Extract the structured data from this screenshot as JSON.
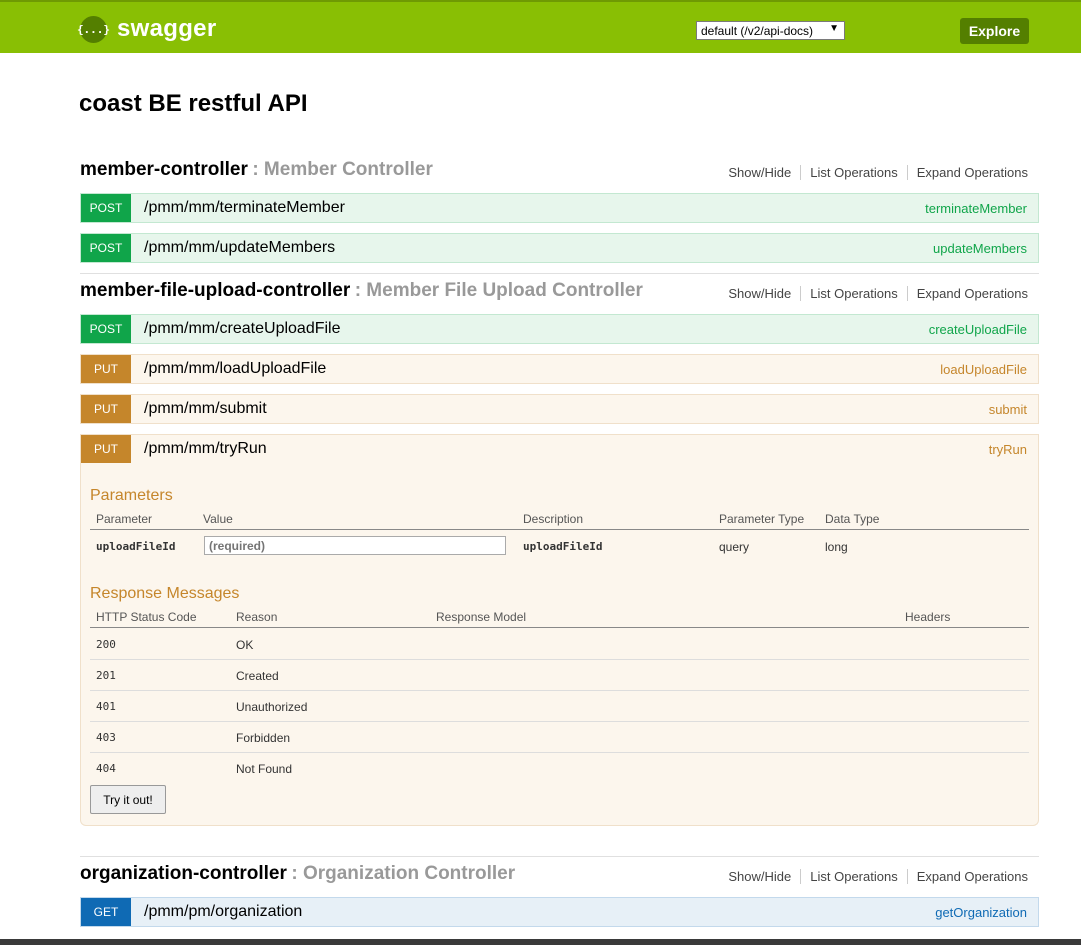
{
  "header": {
    "logo_mark": "{...}",
    "logo_text": "swagger",
    "spec_url": "default (/v2/api-docs)",
    "spec_arrow": "▼",
    "explore_label": "Explore"
  },
  "api_title": "coast BE restful API",
  "section_links": {
    "show_hide": "Show/Hide",
    "list_operations": "List Operations",
    "expand_operations": "Expand Operations"
  },
  "sections": [
    {
      "name": "member-controller",
      "desc": ": Member Controller",
      "operations": [
        {
          "method": "POST",
          "path": "/pmm/mm/terminateMember",
          "nickname": "terminateMember"
        },
        {
          "method": "POST",
          "path": "/pmm/mm/updateMembers",
          "nickname": "updateMembers"
        }
      ]
    },
    {
      "name": "member-file-upload-controller",
      "desc": ": Member File Upload Controller",
      "operations": [
        {
          "method": "POST",
          "path": "/pmm/mm/createUploadFile",
          "nickname": "createUploadFile"
        },
        {
          "method": "PUT",
          "path": "/pmm/mm/loadUploadFile",
          "nickname": "loadUploadFile"
        },
        {
          "method": "PUT",
          "path": "/pmm/mm/submit",
          "nickname": "submit"
        },
        {
          "method": "PUT",
          "path": "/pmm/mm/tryRun",
          "nickname": "tryRun"
        }
      ]
    },
    {
      "name": "organization-controller",
      "desc": ": Organization Controller",
      "operations": [
        {
          "method": "GET",
          "path": "/pmm/pm/organization",
          "nickname": "getOrganization"
        }
      ]
    }
  ],
  "expanded_operation": {
    "parameters_title": "Parameters",
    "param_headers": [
      "Parameter",
      "Value",
      "Description",
      "Parameter Type",
      "Data Type"
    ],
    "params": [
      {
        "name": "uploadFileId",
        "placeholder": "(required)",
        "description": "uploadFileId",
        "param_type": "query",
        "data_type": "long"
      }
    ],
    "responses_title": "Response Messages",
    "response_headers": [
      "HTTP Status Code",
      "Reason",
      "Response Model",
      "Headers"
    ],
    "responses": [
      {
        "code": "200",
        "reason": "OK"
      },
      {
        "code": "201",
        "reason": "Created"
      },
      {
        "code": "401",
        "reason": "Unauthorized"
      },
      {
        "code": "403",
        "reason": "Forbidden"
      },
      {
        "code": "404",
        "reason": "Not Found"
      }
    ],
    "try_label": "Try it out!"
  },
  "colors": {
    "header_bg": "#89bf04",
    "post": "#10a54a",
    "put": "#c5862b",
    "get": "#0f6ab4"
  }
}
